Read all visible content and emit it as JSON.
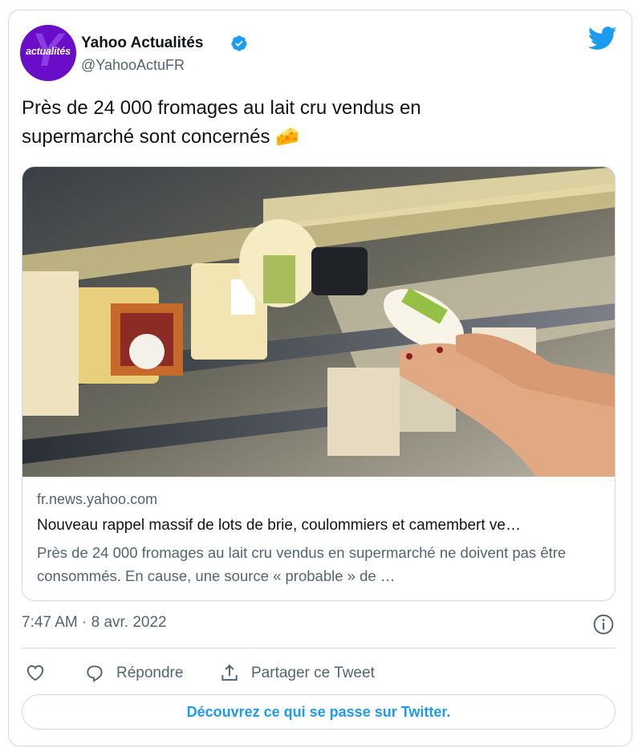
{
  "author": {
    "avatar_text": "actualités",
    "avatar_letter": "Y",
    "name": "Yahoo Actualités",
    "handle": "@YahooActuFR",
    "verified": true
  },
  "tweet": {
    "text_line1": "Près de 24 000 fromages au lait cru vendus en",
    "text_line2": "supermarché sont concernés 🧀"
  },
  "link_card": {
    "image_alt": "cheese-shelf-photo",
    "domain": "fr.news.yahoo.com",
    "title": "Nouveau rappel massif de lots de brie, coulommiers et camembert ve…",
    "description": "Près de 24 000 fromages au lait cru vendus en supermarché ne doivent pas être consommés. En cause, une source « probable » de …"
  },
  "meta": {
    "timestamp": "7:47 AM · 8 avr. 2022"
  },
  "actions": {
    "reply_label": "Répondre",
    "share_label": "Partager ce Tweet"
  },
  "cta": {
    "label": "Découvrez ce qui se passe sur Twitter."
  },
  "colors": {
    "brand_blue": "#1d9bf0",
    "avatar_purple": "#6a0dc9",
    "secondary_text": "#536471",
    "border": "#cfd9de"
  }
}
